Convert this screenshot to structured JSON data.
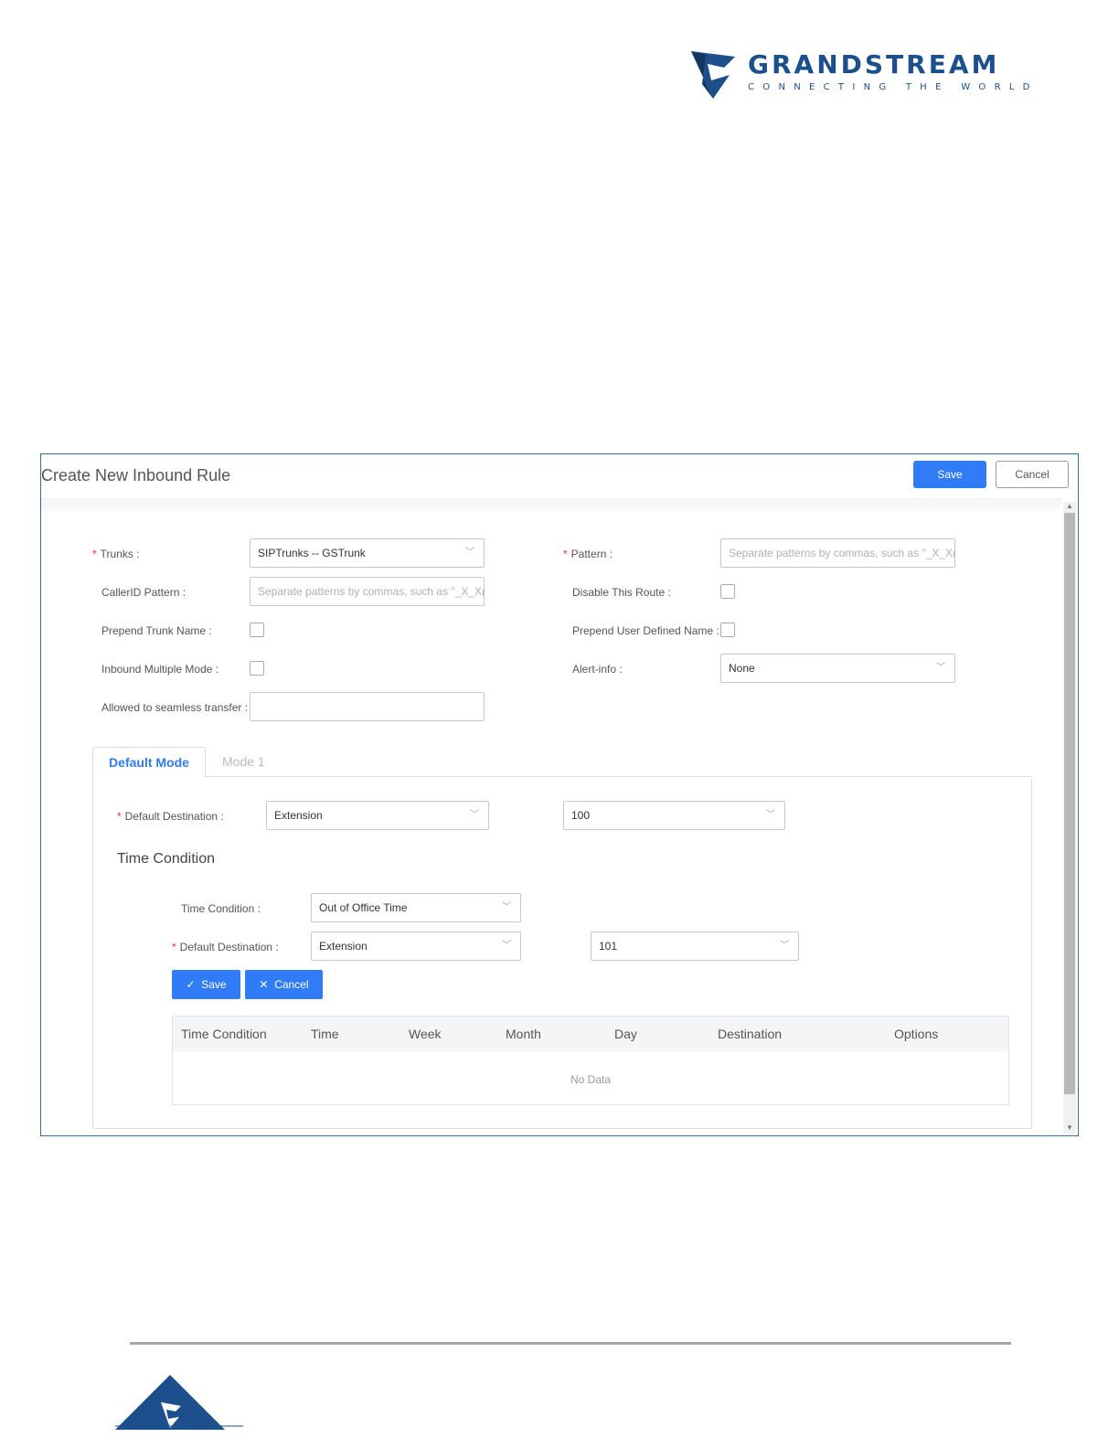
{
  "brand": {
    "name": "GRANDSTREAM",
    "tagline": "CONNECTING THE WORLD",
    "color": "#1d4f8c"
  },
  "dialog": {
    "title": "Create New Inbound Rule",
    "save_label": "Save",
    "cancel_label": "Cancel"
  },
  "form": {
    "trunks": {
      "label": "Trunks :",
      "value": "SIPTrunks -- GSTrunk"
    },
    "pattern": {
      "label": "Pattern :",
      "placeholder": "Separate patterns by commas, such as \"_X_X("
    },
    "callerid_pattern": {
      "label": "CallerID Pattern :",
      "placeholder": "Separate patterns by commas, such as \"_X_X("
    },
    "disable_route": {
      "label": "Disable This Route :",
      "checked": false
    },
    "prepend_trunk_name": {
      "label": "Prepend Trunk Name :",
      "checked": false
    },
    "prepend_user_name": {
      "label": "Prepend User Defined Name :",
      "checked": false
    },
    "inbound_multiple_mode": {
      "label": "Inbound Multiple Mode :",
      "checked": false
    },
    "alert_info": {
      "label": "Alert-info :",
      "value": "None"
    },
    "seamless_transfer": {
      "label": "Allowed to seamless transfer :",
      "value": ""
    }
  },
  "tabs": [
    {
      "label": "Default Mode",
      "active": true
    },
    {
      "label": "Mode 1",
      "active": false
    }
  ],
  "default_mode": {
    "destination_label": "Default Destination :",
    "destination_type": "Extension",
    "destination_value": "100",
    "time_condition_title": "Time Condition",
    "time_condition_label": "Time Condition :",
    "time_condition_value": "Out of Office Time",
    "tc_destination_label": "Default Destination :",
    "tc_destination_type": "Extension",
    "tc_destination_value": "101",
    "save_label": "Save",
    "cancel_label": "Cancel"
  },
  "table": {
    "columns": [
      "Time Condition",
      "Time",
      "Week",
      "Month",
      "Day",
      "Destination",
      "Options"
    ],
    "empty_text": "No Data"
  },
  "colors": {
    "accent": "#2f7cf6",
    "required": "#e33333"
  }
}
